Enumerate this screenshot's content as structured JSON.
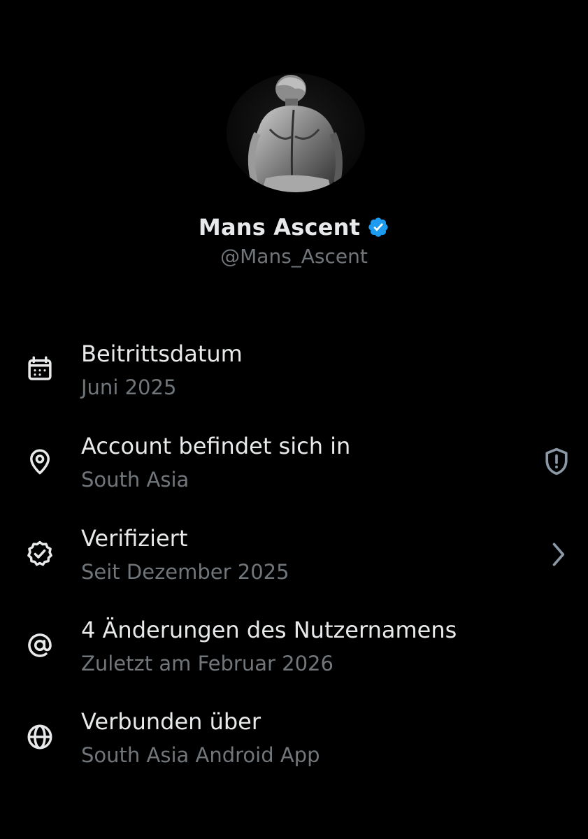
{
  "profile": {
    "display_name": "Mans Ascent",
    "handle": "@Mans_Ascent",
    "verified": true,
    "accent_color": "#1d9bf0"
  },
  "rows": [
    {
      "icon": "calendar-icon",
      "title": "Beitrittsdatum",
      "subtitle": "Juni 2025"
    },
    {
      "icon": "location-pin-icon",
      "title": "Account befindet sich in",
      "subtitle": "South Asia",
      "action_icon": "shield-alert-icon"
    },
    {
      "icon": "verified-check-icon",
      "title": "Verifiziert",
      "subtitle": "Seit Dezember 2025",
      "action_icon": "chevron-right-icon"
    },
    {
      "icon": "at-sign-icon",
      "title": "4 Änderungen des Nutzernamens",
      "subtitle": "Zuletzt am Februar 2026"
    },
    {
      "icon": "globe-icon",
      "title": "Verbunden über",
      "subtitle": "South Asia Android App"
    }
  ],
  "colors": {
    "background": "#000000",
    "primary_text": "#e7e9ea",
    "secondary_text": "#71767b"
  }
}
